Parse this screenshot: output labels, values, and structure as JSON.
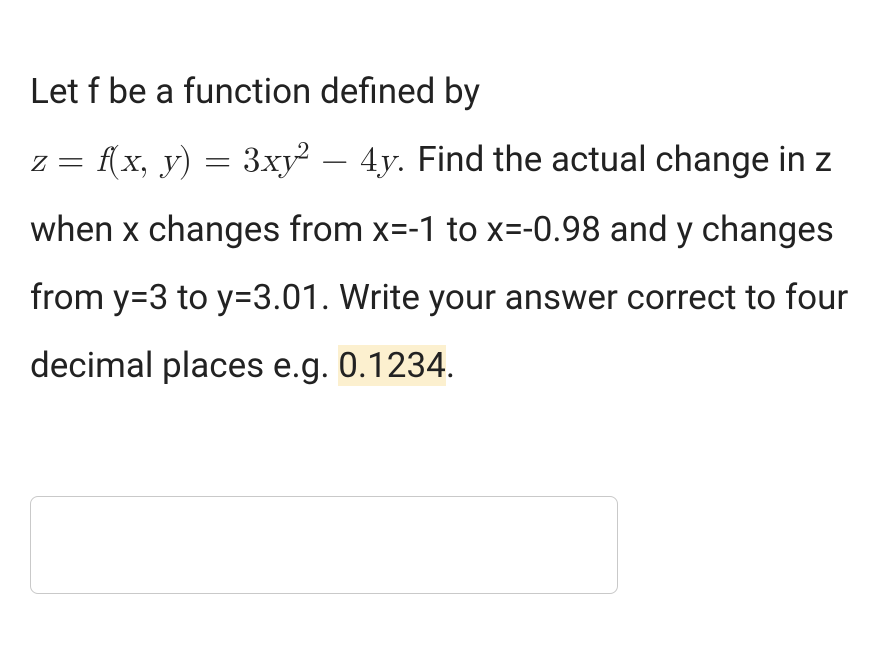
{
  "question": {
    "intro": "Let f be a function defined by",
    "equation": {
      "z": "z",
      "eq1": " = ",
      "f": "f",
      "paren_open": "(",
      "x": "x",
      "comma": ", ",
      "y": "y",
      "paren_close": ")",
      "eq2": " = ",
      "coef1": "3",
      "term_x": "x",
      "term_y": "y",
      "exp": "2",
      "minus": " − ",
      "coef2": "4",
      "term_y2": "y",
      "period": "."
    },
    "find_text": " Find the actual change in z when x changes from x=-1 to x=-0.98 and y changes from y=3 to y=3.01. Write your answer correct to four decimal places e.g. ",
    "highlight_text": "0.1234",
    "end_period": "."
  },
  "answer": {
    "value": "",
    "placeholder": ""
  }
}
